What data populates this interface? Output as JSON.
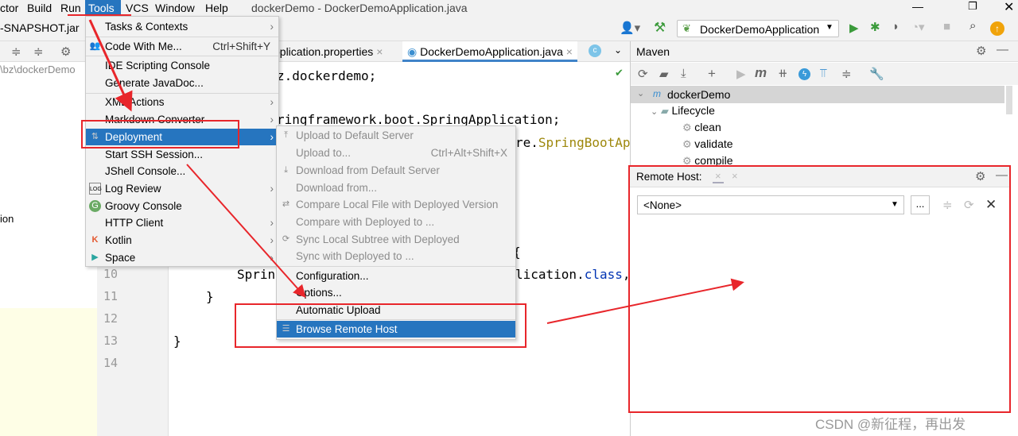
{
  "menubar": {
    "items": [
      "ctor",
      "Build",
      "Run",
      "Tools",
      "VCS",
      "Window",
      "Help"
    ],
    "active": "Tools",
    "window_title": "dockerDemo - DockerDemoApplication.java"
  },
  "toolbar": {
    "breadcrumb": "-SNAPSHOT.jar",
    "run_config": "DockerDemoApplication"
  },
  "project": {
    "path": "\\bz\\dockerDemo",
    "partial": "ion"
  },
  "editor": {
    "tabs": [
      {
        "label": "pplication.properties",
        "active": false
      },
      {
        "label": "DockerDemoApplication.java",
        "active": true
      }
    ],
    "code": [
      {
        "text": "z.dockerdemo;"
      },
      {
        "text": "ringframework.boot.SpringApplication;"
      },
      {
        "text": "re.",
        "highlight": "SpringBootAp"
      },
      {
        "text": "{"
      },
      {
        "text": "Sprin"
      },
      {
        "text": "lication.",
        "keyword": "class",
        "tail": ","
      },
      {
        "text": "}"
      },
      {
        "text": "}"
      }
    ],
    "line_numbers": [
      "10",
      "11",
      "12",
      "13",
      "14"
    ]
  },
  "tools_menu": {
    "items": [
      {
        "label": "Tasks & Contexts",
        "submenu": true
      },
      {
        "label": "Code With Me...",
        "shortcut": "Ctrl+Shift+Y",
        "icon": "users-icon"
      },
      {
        "label": "IDE Scripting Console"
      },
      {
        "label": "Generate JavaDoc..."
      },
      {
        "label": "XML Actions",
        "submenu": true
      },
      {
        "label": "Markdown Converter",
        "submenu": true
      },
      {
        "label": "Deployment",
        "submenu": true,
        "selected": true,
        "icon": "deploy-icon"
      },
      {
        "label": "Start SSH Session..."
      },
      {
        "label": "JShell Console..."
      },
      {
        "label": "Log Review",
        "submenu": true,
        "icon": "log-icon"
      },
      {
        "label": "Groovy Console",
        "icon": "groovy-icon"
      },
      {
        "label": "HTTP Client",
        "submenu": true
      },
      {
        "label": "Kotlin",
        "submenu": true,
        "icon": "kotlin-icon"
      },
      {
        "label": "Space",
        "submenu": true,
        "icon": "space-icon"
      }
    ]
  },
  "deployment_menu": {
    "items": [
      {
        "label": "Upload to Default Server",
        "disabled": true
      },
      {
        "label": "Upload to...",
        "shortcut": "Ctrl+Alt+Shift+X",
        "disabled": true
      },
      {
        "label": "Download from Default Server",
        "disabled": true
      },
      {
        "label": "Download from...",
        "disabled": true
      },
      {
        "label": "Compare Local File with Deployed Version",
        "disabled": true
      },
      {
        "label": "Compare with Deployed to ...",
        "disabled": true
      },
      {
        "label": "Sync Local Subtree with Deployed",
        "disabled": true
      },
      {
        "label": "Sync with Deployed to ...",
        "disabled": true
      },
      {
        "label": "Configuration..."
      },
      {
        "label": "Options..."
      },
      {
        "label": "Automatic Upload"
      },
      {
        "label": "Browse Remote Host",
        "selected": true
      }
    ]
  },
  "maven": {
    "title": "Maven",
    "tree": [
      {
        "label": "dockerDemo"
      },
      {
        "label": "Lifecycle"
      },
      {
        "label": "clean"
      },
      {
        "label": "validate"
      },
      {
        "label": "compile"
      }
    ]
  },
  "remote_host": {
    "title": "Remote Host:",
    "server_value": "<None>",
    "browse_label": "..."
  },
  "watermark": "CSDN @新征程，再出发",
  "colors": {
    "selection": "#2675bf",
    "annotation": "#e8262b"
  }
}
